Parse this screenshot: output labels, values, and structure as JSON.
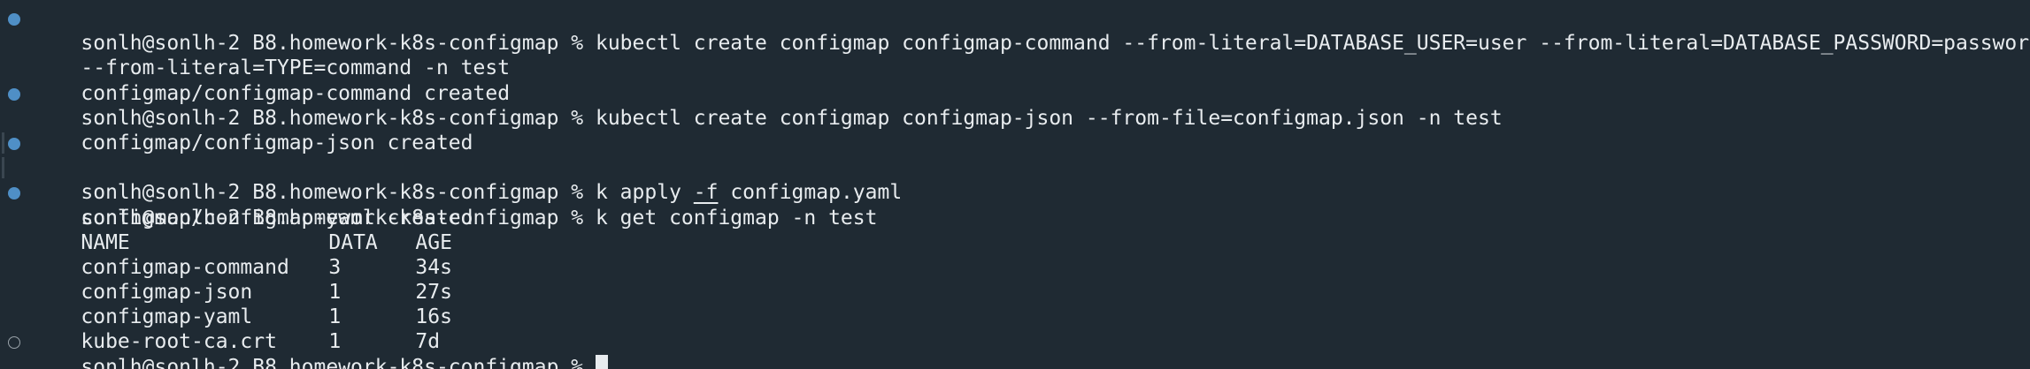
{
  "prompt": "sonlh@sonlh-2 B8.homework-k8s-configmap % ",
  "lines": [
    {
      "type": "cmd",
      "text": "kubectl create configmap configmap-command --from-literal=DATABASE_USER=user --from-literal=DATABASE_PASSWORD=password"
    },
    {
      "type": "cont",
      "text": "--from-literal=TYPE=command -n test"
    },
    {
      "type": "out",
      "text": "configmap/configmap-command created"
    },
    {
      "type": "cmd",
      "text": "kubectl create configmap configmap-json --from-file=configmap.json -n test"
    },
    {
      "type": "out",
      "text": "configmap/configmap-json created"
    },
    {
      "type": "cmd_apply",
      "pre": "k apply ",
      "flag": "-f",
      "post": " configmap.yaml"
    },
    {
      "type": "out",
      "text": "configmap/configmap-yaml created"
    },
    {
      "type": "cmd",
      "text": "k get configmap -n test"
    }
  ],
  "table": {
    "headers": [
      "NAME",
      "DATA",
      "AGE"
    ],
    "rows": [
      [
        "configmap-command",
        "3",
        "34s"
      ],
      [
        "configmap-json",
        "1",
        "27s"
      ],
      [
        "configmap-yaml",
        "1",
        "16s"
      ],
      [
        "kube-root-ca.crt",
        "1",
        "7d"
      ]
    ]
  },
  "colors": {
    "background": "#1f2a33",
    "foreground": "#e8ecef",
    "marker_success": "#4f8fc6",
    "marker_pending": "#9aa3aa"
  },
  "icons": {
    "command_marker": "filled-circle",
    "active_marker": "hollow-circle"
  }
}
